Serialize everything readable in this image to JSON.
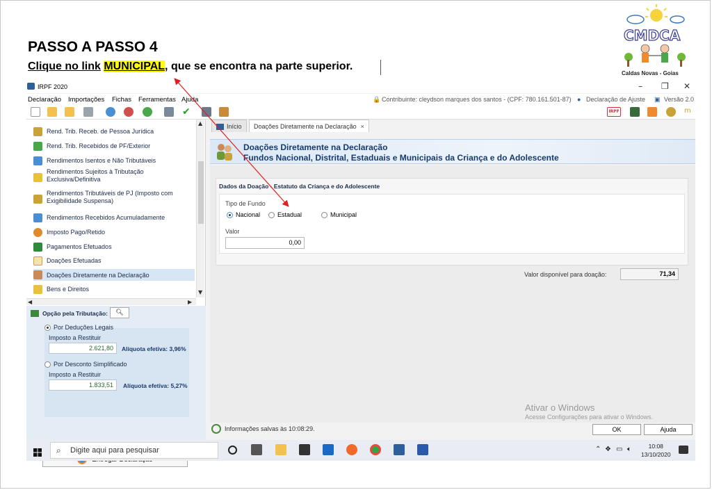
{
  "slide": {
    "heading": "PASSO A PASSO 4",
    "instruction": {
      "part1": "Clique  no link",
      "highlight": "MUNICIPAL",
      "part2": ", que se encontra na parte superior."
    },
    "logo_text": "CMDCA",
    "logo_caption": "Caldas Novas - Goias"
  },
  "window": {
    "title": "IRPF 2020",
    "controls": {
      "minimize": "–",
      "maximize": "❐",
      "close": "✕"
    }
  },
  "menu": {
    "items": [
      "Declaração",
      "Importações",
      "Fichas",
      "Ferramentas",
      "Ajuda"
    ],
    "contribuinte": "Contribuinte: cleydson marques dos santos - (CPF: 780.161.501-87)",
    "declaracao_ajuste": "Declaração de Ajuste",
    "versao": "Versão 2.0"
  },
  "toolbar": {
    "irpf_badge": "IRPF"
  },
  "sidebar": {
    "items": [
      {
        "label": "Rend. Trib. Receb. de Pessoa Jurídica"
      },
      {
        "label": "Rend. Trib. Recebidos de PF/Exterior"
      },
      {
        "label": "Rendimentos Isentos e Não Tributáveis"
      },
      {
        "label": "Rendimentos Sujeitos à Tributação",
        "label2": "Exclusiva/Definitiva"
      },
      {
        "label": "Rendimentos Tributáveis de PJ (Imposto com",
        "label2": "Exigibilidade Suspensa)"
      },
      {
        "label": "Rendimentos Recebidos Acumuladamente"
      },
      {
        "label": "Imposto Pago/Retido"
      },
      {
        "label": "Pagamentos Efetuados"
      },
      {
        "label": "Doações Efetuadas"
      },
      {
        "label": "Doações Diretamente na Declaração"
      },
      {
        "label": "Bens e Direitos"
      }
    ],
    "opcao_title": "Opção pela Tributação:",
    "deducoes_label": "Por Deduções Legais",
    "imposto_label_1": "Imposto a Restituir",
    "deducoes_value": "2.621,80",
    "deducoes_aliquota": "Alíquota efetiva: 3,96%",
    "simplificado_label": "Por Desconto Simplificado",
    "imposto_label_2": "Imposto a Restituir",
    "simplificado_value": "1.833,51",
    "simplificado_aliquota": "Alíquota efetiva: 5,27%",
    "entregar_label": "Entregar Declaração"
  },
  "main": {
    "tabs": [
      {
        "label": "Início"
      },
      {
        "label": "Doações Diretamente na Declaração",
        "close": "×"
      }
    ],
    "banner_title": "Doações Diretamente na Declaração",
    "banner_subtitle": "Fundos Nacional, Distrital, Estaduais e Municipais da Criança e do Adolescente",
    "section_title": "Dados da Doação - Estatuto da Criança e do Adolescente",
    "tipo_fundo_label": "Tipo de Fundo",
    "fundo_options": [
      "Nacional",
      "Estadual",
      "Municipal"
    ],
    "fundo_selected": "Nacional",
    "valor_label": "Valor",
    "valor": "0,00",
    "disponivel_label": "Valor disponível para doação:",
    "disponivel_valor": "71,34",
    "status": "Informações salvas às 10:08:29.",
    "watermark_1": "Ativar o Windows",
    "watermark_2": "Acesse Configurações para ativar o Windows.",
    "ok_label": "OK",
    "ajuda_label": "Ajuda"
  },
  "taskbar": {
    "search_placeholder": "Digite aqui para pesquisar",
    "time": "10:08",
    "date": "13/10/2020"
  },
  "colors": {
    "highlight": "#ffff00",
    "arrow": "#e02020",
    "banner_text": "#163a70",
    "selected_item": "#d6e6f5"
  }
}
